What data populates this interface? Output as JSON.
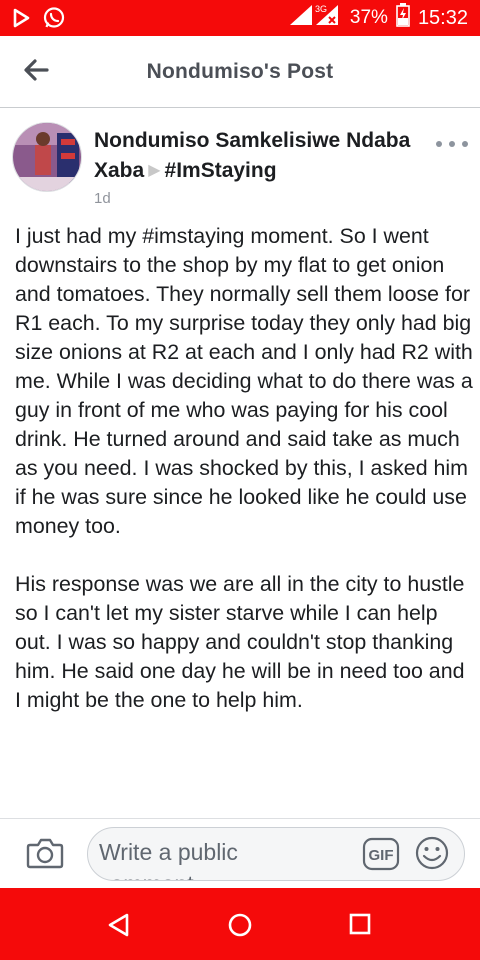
{
  "status_bar": {
    "network": "3G",
    "battery": "37%",
    "time": "15:32",
    "icons": [
      "play-store-icon",
      "whatsapp-icon",
      "signal-icon",
      "battery-icon"
    ]
  },
  "header": {
    "title": "Nondumiso's Post",
    "back_icon": "arrow-left-icon"
  },
  "post": {
    "author": "Nondumiso Samkelisiwe Ndaba Xaba",
    "target": "#ImStaying",
    "time": "1d",
    "paragraphs": [
      "I just had my #imstaying moment. So I went downstairs to the shop by my flat to get onion and tomatoes. They normally sell them loose for R1 each. To my surprise today they only had big size onions at R2 at each and I only had R2 with me. While I was deciding what to do there was a guy in front of me who was paying for his cool drink. He turned around and said take as much as you need. I was shocked by this, I asked him if he was sure since he looked like he could use money too.",
      "His response was we are all in the city to hustle so I can't let my sister starve while I can help out. I was so happy and couldn't stop thanking him. He said one day he will be in need too and I might be the one to help him."
    ]
  },
  "comment_bar": {
    "placeholder": "Write a public comment...",
    "gif_label": "GIF"
  },
  "colors": {
    "system_bar": "#f50a0a",
    "text": "#1c1e21",
    "muted": "#90949c"
  }
}
